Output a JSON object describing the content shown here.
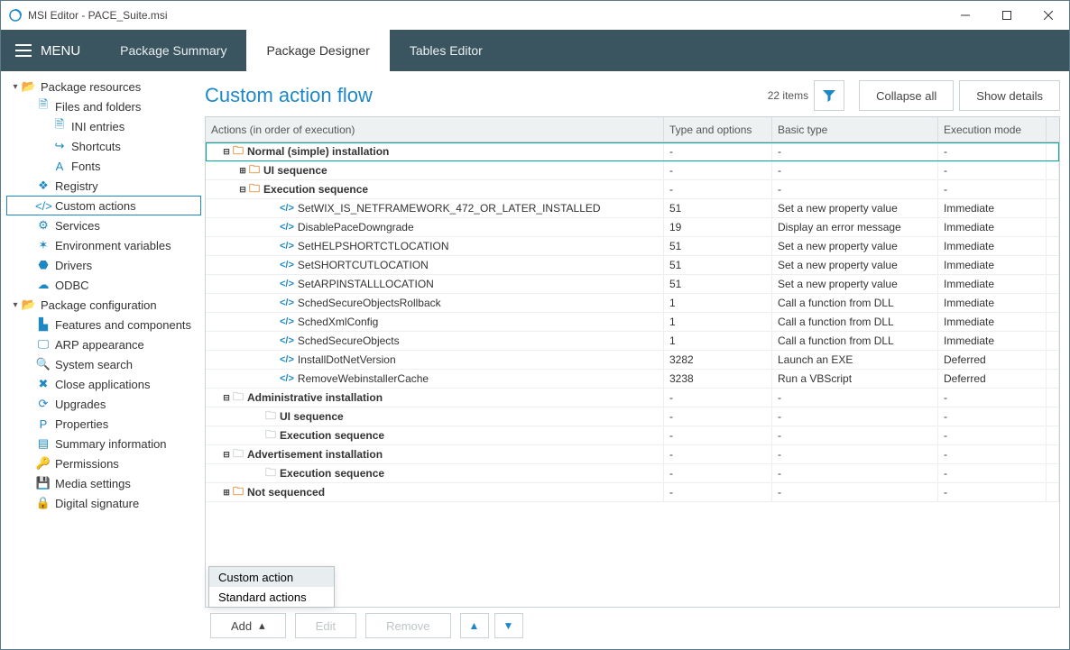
{
  "window": {
    "title": "MSI Editor - PACE_Suite.msi"
  },
  "menubar": {
    "menu_label": "MENU",
    "tabs": [
      {
        "label": "Package Summary",
        "active": false
      },
      {
        "label": "Package Designer",
        "active": true
      },
      {
        "label": "Tables Editor",
        "active": false
      }
    ]
  },
  "sidebar": {
    "sections": [
      {
        "label": "Package resources",
        "icon": "folder-open-icon",
        "expanded": true,
        "items": [
          {
            "label": "Files and folders",
            "icon": "file-icon",
            "children": [
              {
                "label": "INI entries",
                "icon": "ini-icon"
              },
              {
                "label": "Shortcuts",
                "icon": "shortcut-icon"
              },
              {
                "label": "Fonts",
                "icon": "font-icon"
              }
            ]
          },
          {
            "label": "Registry",
            "icon": "registry-icon"
          },
          {
            "label": "Custom actions",
            "icon": "code-icon",
            "selected": true
          },
          {
            "label": "Services",
            "icon": "gear-icon"
          },
          {
            "label": "Environment variables",
            "icon": "env-icon"
          },
          {
            "label": "Drivers",
            "icon": "driver-icon"
          },
          {
            "label": "ODBC",
            "icon": "odbc-icon"
          }
        ]
      },
      {
        "label": "Package configuration",
        "icon": "folder-open-icon",
        "expanded": true,
        "items": [
          {
            "label": "Features and components",
            "icon": "features-icon"
          },
          {
            "label": "ARP appearance",
            "icon": "monitor-icon"
          },
          {
            "label": "System search",
            "icon": "search-icon"
          },
          {
            "label": "Close applications",
            "icon": "close-app-icon"
          },
          {
            "label": "Upgrades",
            "icon": "upgrade-icon"
          },
          {
            "label": "Properties",
            "icon": "properties-icon"
          },
          {
            "label": "Summary information",
            "icon": "summary-icon"
          },
          {
            "label": "Permissions",
            "icon": "key-icon"
          },
          {
            "label": "Media settings",
            "icon": "media-icon"
          },
          {
            "label": "Digital signature",
            "icon": "lock-icon"
          }
        ]
      }
    ]
  },
  "page": {
    "title": "Custom action flow",
    "items_count": "22 items",
    "collapse_label": "Collapse all",
    "details_label": "Show details"
  },
  "grid": {
    "columns": [
      "Actions (in order of execution)",
      "Type and options",
      "Basic type",
      "Execution mode"
    ],
    "rows": [
      {
        "indent": 0,
        "caret": "⊟",
        "folder": true,
        "label": "Normal (simple) installation",
        "c2": "-",
        "c3": "-",
        "c4": "-",
        "bold": true,
        "selected": true
      },
      {
        "indent": 1,
        "caret": "⊞",
        "folder": true,
        "label": "UI sequence",
        "c2": "-",
        "c3": "-",
        "c4": "-",
        "bold": true
      },
      {
        "indent": 1,
        "caret": "⊟",
        "folder": true,
        "label": "Execution sequence",
        "c2": "-",
        "c3": "-",
        "c4": "-",
        "bold": true
      },
      {
        "indent": 3,
        "action": true,
        "label": "SetWIX_IS_NETFRAMEWORK_472_OR_LATER_INSTALLED",
        "c2": "51",
        "c3": "Set a new property value",
        "c4": "Immediate"
      },
      {
        "indent": 3,
        "action": true,
        "label": "DisablePaceDowngrade",
        "c2": "19",
        "c3": "Display an error message",
        "c4": "Immediate"
      },
      {
        "indent": 3,
        "action": true,
        "label": "SetHELPSHORTCTLOCATION",
        "c2": "51",
        "c3": "Set a new property value",
        "c4": "Immediate"
      },
      {
        "indent": 3,
        "action": true,
        "label": "SetSHORTCUTLOCATION",
        "c2": "51",
        "c3": "Set a new property value",
        "c4": "Immediate"
      },
      {
        "indent": 3,
        "action": true,
        "label": "SetARPINSTALLLOCATION",
        "c2": "51",
        "c3": "Set a new property value",
        "c4": "Immediate"
      },
      {
        "indent": 3,
        "action": true,
        "label": "SchedSecureObjectsRollback",
        "c2": "1",
        "c3": "Call a function from DLL",
        "c4": "Immediate"
      },
      {
        "indent": 3,
        "action": true,
        "label": "SchedXmlConfig",
        "c2": "1",
        "c3": "Call a function from DLL",
        "c4": "Immediate"
      },
      {
        "indent": 3,
        "action": true,
        "label": "SchedSecureObjects",
        "c2": "1",
        "c3": "Call a function from DLL",
        "c4": "Immediate"
      },
      {
        "indent": 3,
        "action": true,
        "label": "InstallDotNetVersion",
        "c2": "3282",
        "c3": "Launch an EXE",
        "c4": "Deferred"
      },
      {
        "indent": 3,
        "action": true,
        "label": "RemoveWebinstallerCache",
        "c2": "3238",
        "c3": "Run a VBScript",
        "c4": "Deferred"
      },
      {
        "indent": 0,
        "caret": "⊟",
        "folder": true,
        "grey": true,
        "label": "Administrative installation",
        "c2": "-",
        "c3": "-",
        "c4": "-",
        "bold": true
      },
      {
        "indent": 2,
        "folder": true,
        "grey": true,
        "label": "UI sequence",
        "c2": "-",
        "c3": "-",
        "c4": "-",
        "bold": true
      },
      {
        "indent": 2,
        "folder": true,
        "grey": true,
        "label": "Execution sequence",
        "c2": "-",
        "c3": "-",
        "c4": "-",
        "bold": true
      },
      {
        "indent": 0,
        "caret": "⊟",
        "folder": true,
        "grey": true,
        "label": "Advertisement installation",
        "c2": "-",
        "c3": "-",
        "c4": "-",
        "bold": true
      },
      {
        "indent": 2,
        "folder": true,
        "grey": true,
        "label": "Execution sequence",
        "c2": "-",
        "c3": "-",
        "c4": "-",
        "bold": true
      },
      {
        "indent": 0,
        "caret": "⊞",
        "folder": true,
        "label": "Not sequenced",
        "c2": "-",
        "c3": "-",
        "c4": "-",
        "bold": true
      }
    ]
  },
  "popup": {
    "items": [
      "Custom action",
      "Standard actions"
    ]
  },
  "footer": {
    "add": "Add",
    "edit": "Edit",
    "remove": "Remove"
  }
}
